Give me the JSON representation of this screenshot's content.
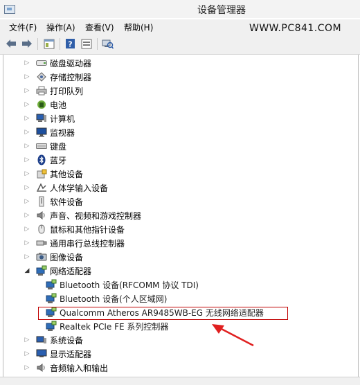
{
  "window": {
    "title": "设备管理器"
  },
  "watermark": "WWW.PC841.COM",
  "menu": [
    {
      "label": "文件(F)"
    },
    {
      "label": "操作(A)"
    },
    {
      "label": "查看(V)"
    },
    {
      "label": "帮助(H)"
    }
  ],
  "toolbar": {
    "buttons": [
      "back-icon",
      "forward-icon",
      "properties-icon",
      "help-icon",
      "view-icon",
      "scan-hardware-icon"
    ]
  },
  "tree": {
    "categories": [
      {
        "label": "磁盘驱动器",
        "icon": "disk-drive-icon",
        "expanded": false
      },
      {
        "label": "存储控制器",
        "icon": "storage-controller-icon",
        "expanded": false
      },
      {
        "label": "打印队列",
        "icon": "printer-icon",
        "expanded": false
      },
      {
        "label": "电池",
        "icon": "battery-icon",
        "expanded": false
      },
      {
        "label": "计算机",
        "icon": "computer-icon",
        "expanded": false
      },
      {
        "label": "监视器",
        "icon": "monitor-icon",
        "expanded": false
      },
      {
        "label": "键盘",
        "icon": "keyboard-icon",
        "expanded": false
      },
      {
        "label": "蓝牙",
        "icon": "bluetooth-icon",
        "expanded": false
      },
      {
        "label": "其他设备",
        "icon": "other-devices-icon",
        "expanded": false
      },
      {
        "label": "人体学输入设备",
        "icon": "hid-icon",
        "expanded": false
      },
      {
        "label": "软件设备",
        "icon": "software-device-icon",
        "expanded": false
      },
      {
        "label": "声音、视频和游戏控制器",
        "icon": "sound-icon",
        "expanded": false
      },
      {
        "label": "鼠标和其他指针设备",
        "icon": "mouse-icon",
        "expanded": false
      },
      {
        "label": "通用串行总线控制器",
        "icon": "usb-icon",
        "expanded": false
      },
      {
        "label": "图像设备",
        "icon": "camera-icon",
        "expanded": false
      },
      {
        "label": "网络适配器",
        "icon": "network-adapter-icon",
        "expanded": true,
        "children": [
          {
            "label": "Bluetooth 设备(RFCOMM 协议 TDI)"
          },
          {
            "label": "Bluetooth 设备(个人区域网)"
          },
          {
            "label": "Qualcomm Atheros AR9485WB-EG 无线网络适配器",
            "highlighted": true
          },
          {
            "label": "Realtek PCIe FE 系列控制器"
          }
        ]
      },
      {
        "label": "系统设备",
        "icon": "system-device-icon",
        "expanded": false
      },
      {
        "label": "显示适配器",
        "icon": "display-adapter-icon",
        "expanded": false
      },
      {
        "label": "音频输入和输出",
        "icon": "audio-io-icon",
        "expanded": false
      }
    ]
  },
  "colors": {
    "highlight_border": "#c00000",
    "arrow": "#e02020"
  }
}
